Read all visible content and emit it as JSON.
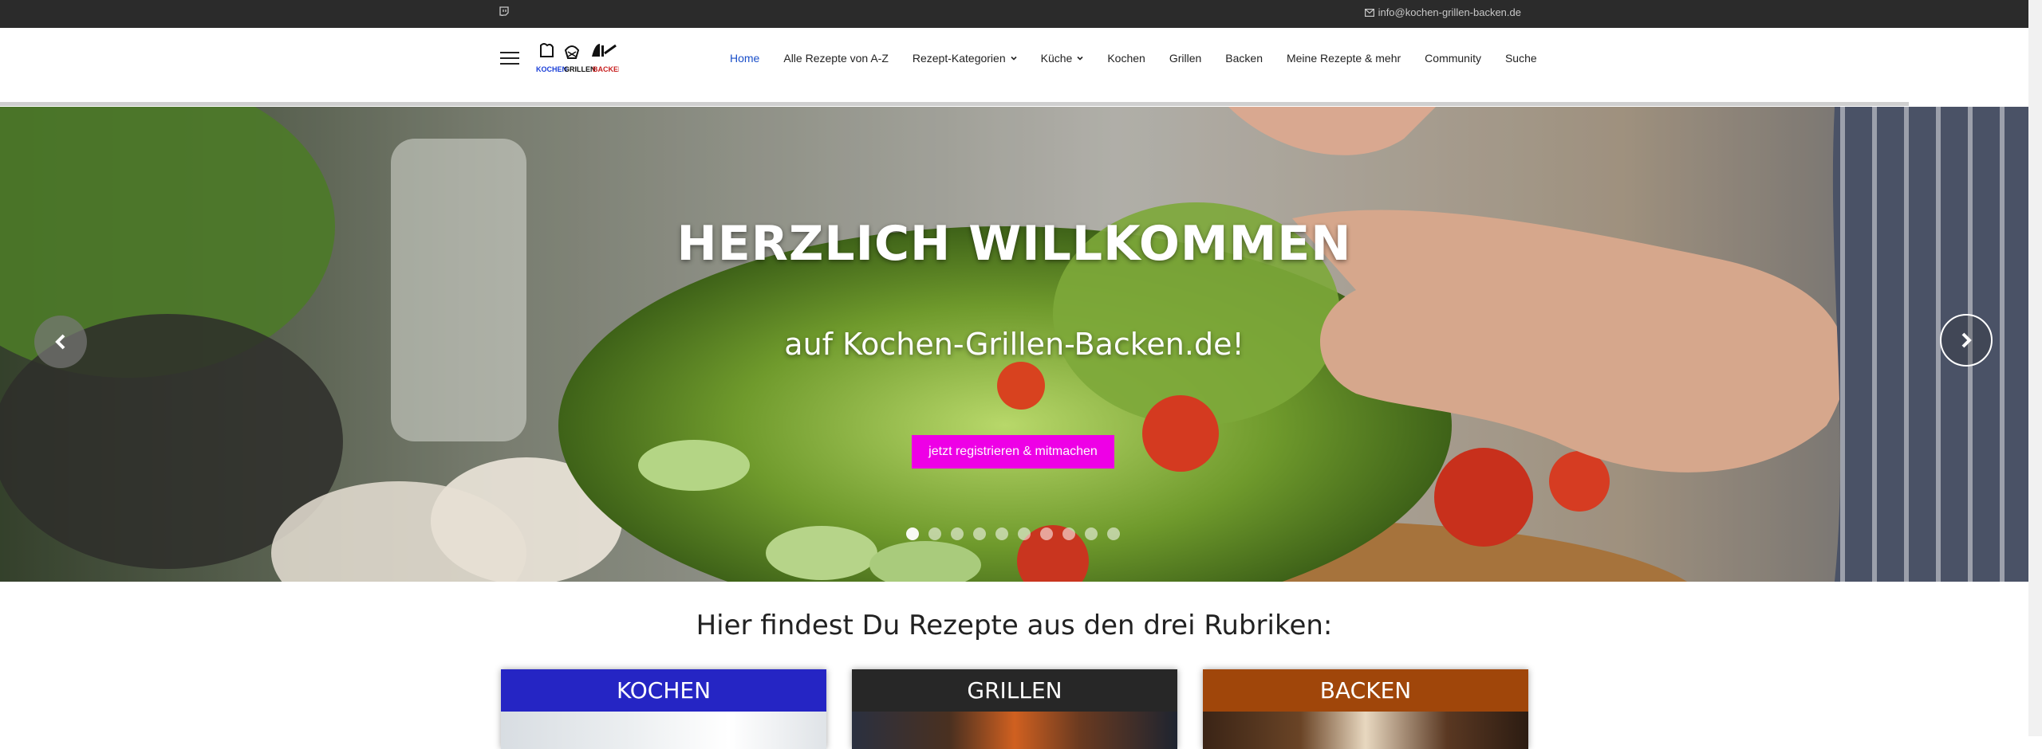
{
  "topbar": {
    "email": "info@kochen-grillen-backen.de",
    "social_icon": "twitch-icon",
    "mail_icon": "envelope-icon"
  },
  "header": {
    "logo_words": [
      "KOCHEN",
      "GRILLEN",
      "BACKEN"
    ],
    "nav": [
      {
        "label": "Home",
        "active": true
      },
      {
        "label": "Alle Rezepte von A-Z"
      },
      {
        "label": "Rezept-Kategorien",
        "dropdown": true
      },
      {
        "label": "Küche",
        "dropdown": true
      },
      {
        "label": "Kochen"
      },
      {
        "label": "Grillen"
      },
      {
        "label": "Backen"
      },
      {
        "label": "Meine Rezepte & mehr"
      },
      {
        "label": "Community"
      },
      {
        "label": "Suche"
      }
    ]
  },
  "hero": {
    "title": "HERZLICH WILLKOMMEN",
    "subtitle": "auf Kochen-Grillen-Backen.de!",
    "button": "jetzt registrieren & mitmachen",
    "slide_count": 10,
    "active_slide": 1,
    "button_color": "#ee00e6"
  },
  "section": {
    "title": "Hier findest Du Rezepte aus den drei Rubriken:"
  },
  "cards": [
    {
      "title": "KOCHEN",
      "color": "#2525c4"
    },
    {
      "title": "GRILLEN",
      "color": "#272727"
    },
    {
      "title": "BACKEN",
      "color": "#a0460a"
    }
  ],
  "accent": "#1a4fc9"
}
